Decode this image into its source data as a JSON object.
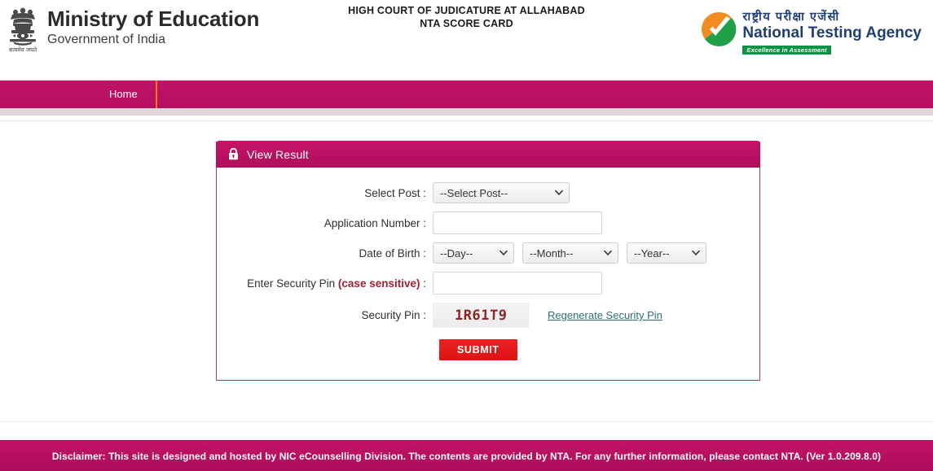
{
  "header": {
    "ministry_title": "Ministry of Education",
    "ministry_subtitle": "Government of India",
    "emblem_motto": "सत्यमेव जयते",
    "center_line1": "HIGH COURT OF JUDICATURE AT ALLAHABAD",
    "center_line2": "NTA SCORE CARD",
    "nta_hindi": "राष्ट्रीय परीक्षा एजेंसी",
    "nta_english": "National Testing Agency",
    "nta_tagline": "Excellence in Assessment"
  },
  "nav": {
    "items": [
      {
        "label": "Home"
      }
    ]
  },
  "panel": {
    "title": "View Result",
    "lock_icon": "lock-icon",
    "fields": {
      "select_post": {
        "label": "Select Post :",
        "value": "--Select Post--",
        "options": [
          "--Select Post--"
        ]
      },
      "application_number": {
        "label": "Application Number :",
        "value": "",
        "placeholder": ""
      },
      "date_of_birth": {
        "label": "Date of Birth :",
        "day": {
          "value": "--Day--",
          "options": [
            "--Day--"
          ]
        },
        "month": {
          "value": "--Month--",
          "options": [
            "--Month--"
          ]
        },
        "year": {
          "value": "--Year--",
          "options": [
            "--Year--"
          ]
        }
      },
      "enter_security_pin": {
        "label_main": "Enter Security Pin ",
        "label_note": "(case sensitive)",
        "label_colon": " :",
        "value": "",
        "placeholder": ""
      },
      "security_pin": {
        "label": "Security Pin :",
        "captcha_value": "1R61T9",
        "regenerate_label": "Regenerate Security Pin"
      }
    },
    "submit_label": "SUBMIT"
  },
  "footer": {
    "disclaimer": "Disclaimer: This site is designed and hosted by NIC eCounselling Division. The contents are provided by NTA. For any further information, please contact NTA. (Ver 1.0.209.8.0)"
  },
  "colors": {
    "brand_magenta": "#bd1263",
    "accent_orange": "#f07d1a",
    "submit_red": "#e81e1e",
    "link_teal": "#2e6e78",
    "case_sensitive_red": "#a42030",
    "nta_blue": "#1f3f73",
    "nta_green": "#0c9244"
  }
}
